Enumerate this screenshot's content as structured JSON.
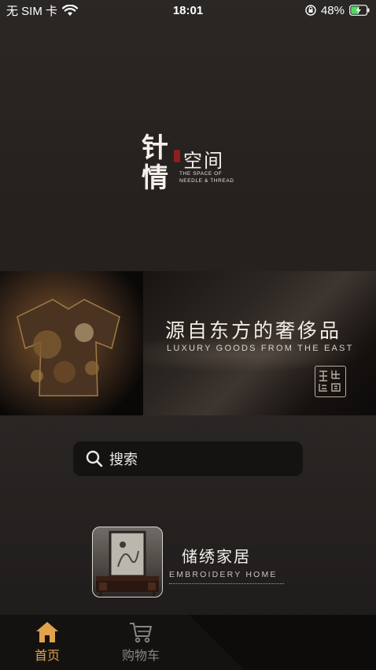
{
  "status_bar": {
    "carrier": "无 SIM 卡",
    "time": "18:01",
    "battery": "48%",
    "icons": [
      "wifi-icon",
      "lock-rotation-icon",
      "battery-charging-icon"
    ]
  },
  "logo": {
    "char_1": "针",
    "char_2": "情",
    "space_title": "空间",
    "subtitle_line_1": "THE SPACE OF",
    "subtitle_line_2": "NEEDLE & THREAD"
  },
  "banner": {
    "title": "源自东方的奢侈品",
    "subtitle": "LUXURY GOODS FROM THE EAST"
  },
  "search": {
    "placeholder": "搜索",
    "icon": "search-icon"
  },
  "categories": [
    {
      "title": "储绣家居",
      "subtitle": "EMBROIDERY HOME"
    }
  ],
  "tab_bar": {
    "tabs": [
      {
        "label": "首页",
        "icon": "home-icon",
        "active": true
      },
      {
        "label": "购物车",
        "icon": "cart-icon",
        "active": false
      }
    ],
    "colors": {
      "active": "#e0a24b",
      "inactive": "#8a8580"
    }
  }
}
